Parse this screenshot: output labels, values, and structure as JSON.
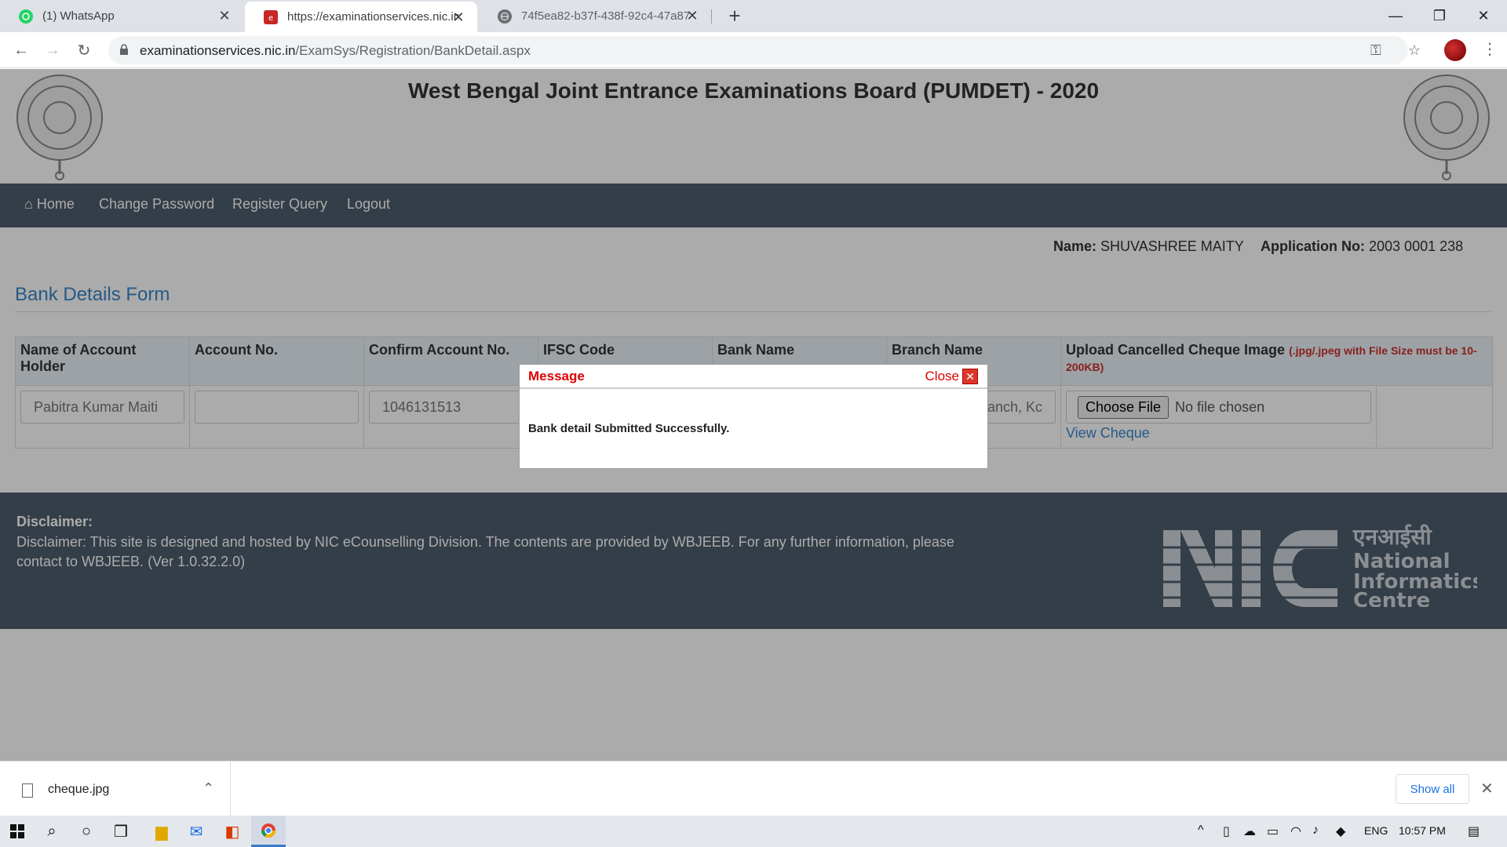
{
  "browser": {
    "tabs": [
      {
        "title": "(1) WhatsApp",
        "active": false,
        "icon": "whatsapp-icon"
      },
      {
        "title": "https://examinationservices.nic.in",
        "active": true,
        "icon": "site-favicon"
      },
      {
        "title": "74f5ea82-b37f-438f-92c4-47a87",
        "active": false,
        "icon": "globe-icon"
      }
    ],
    "url_host": "examinationservices.nic.in",
    "url_path": "/ExamSys/Registration/BankDetail.aspx"
  },
  "page": {
    "title": "West Bengal Joint Entrance Examinations Board (PUMDET) - 2020",
    "nav": [
      "Home",
      "Change Password",
      "Register Query",
      "Logout"
    ],
    "name_label": "Name:",
    "name_value": "SHUVASHREE MAITY",
    "appno_label": "Application No:",
    "appno_value": "2003 0001 238",
    "form_title": "Bank Details Form",
    "columns": [
      "Name of Account Holder",
      "Account No.",
      "Confirm Account No.",
      "IFSC Code",
      "Bank Name",
      "Branch Name",
      "Upload Cancelled Cheque Image"
    ],
    "upload_hint": "(.jpg/.jpeg with File Size must be 10-200KB)",
    "row": {
      "account_holder": "Pabitra Kumar Maiti",
      "account_no": "",
      "confirm_account_no": "1046131513",
      "branch_name": "Branch, Kc",
      "choose_file": "Choose File",
      "no_file": "No file chosen",
      "view_cheque": "View Cheque"
    },
    "disclaimer_head": "Disclaimer:",
    "disclaimer_text": "Disclaimer: This site is designed and hosted by NIC eCounselling Division. The contents are provided by WBJEEB. For any further information, please contact to WBJEEB. (Ver 1.0.32.2.0)",
    "nic_logo_hindi": "एनआईसी",
    "nic_logo_lines": [
      "National",
      "Informatics",
      "Centre"
    ]
  },
  "modal": {
    "title": "Message",
    "close_label": "Close",
    "body": "Bank detail Submitted Successfully."
  },
  "downloads": {
    "file": "cheque.jpg",
    "show_all": "Show all"
  },
  "taskbar": {
    "lang": "ENG",
    "time": "10:57 PM"
  },
  "colors": {
    "navbar": "#4e5d6c",
    "link": "#3a87c8",
    "modal_red": "#d00"
  }
}
